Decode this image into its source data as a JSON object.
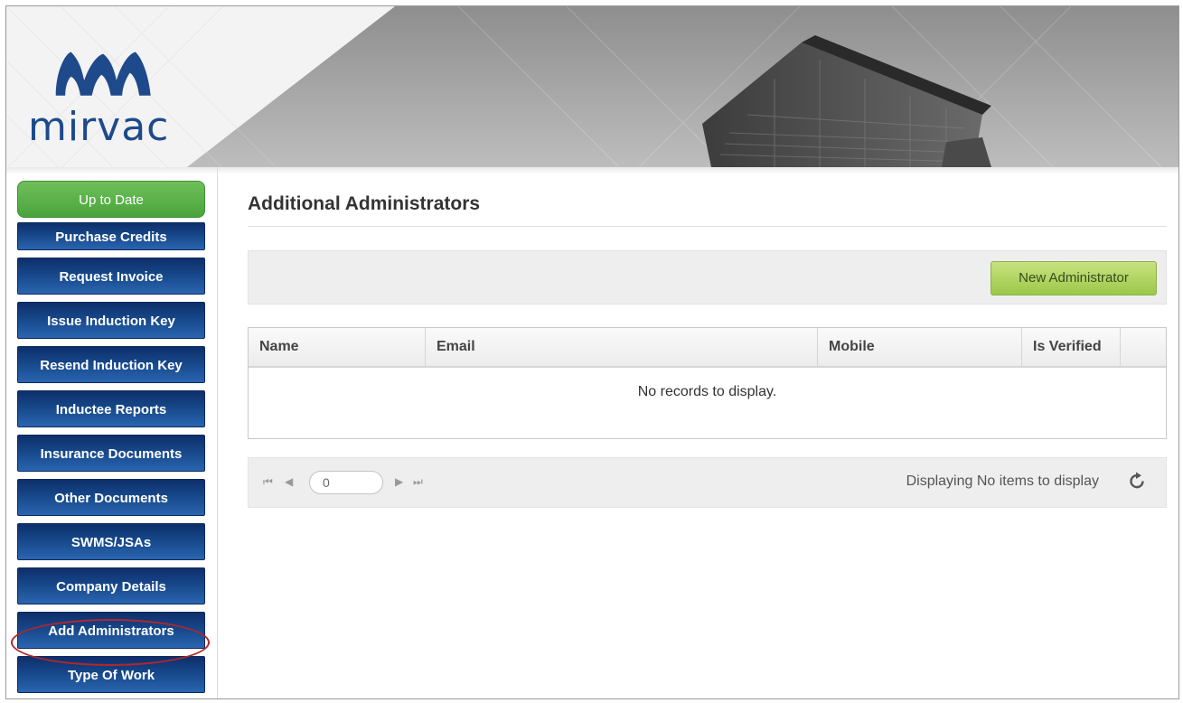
{
  "brand": {
    "logo_text": "mirvac",
    "logo_color": "#1e4a8c"
  },
  "sidebar": {
    "items": [
      {
        "label": "Up to Date",
        "style": "green"
      },
      {
        "label": "Purchase Credits"
      },
      {
        "label": "Request Invoice"
      },
      {
        "label": "Issue Induction Key"
      },
      {
        "label": "Resend Induction Key"
      },
      {
        "label": "Inductee Reports"
      },
      {
        "label": "Insurance Documents"
      },
      {
        "label": "Other Documents"
      },
      {
        "label": "SWMS/JSAs"
      },
      {
        "label": "Company Details"
      },
      {
        "label": "Add Administrators",
        "highlighted": true
      },
      {
        "label": "Type Of Work"
      }
    ]
  },
  "main": {
    "title": "Additional Administrators",
    "toolbar": {
      "new_button": "New Administrator"
    },
    "grid": {
      "columns": [
        "Name",
        "Email",
        "Mobile",
        "Is Verified"
      ],
      "empty_message": "No records to display."
    },
    "pager": {
      "page_value": "0",
      "status": "Displaying No items to display",
      "icons": [
        "first-page-icon",
        "prev-page-icon",
        "next-page-icon",
        "last-page-icon",
        "refresh-icon"
      ]
    }
  },
  "colors": {
    "nav_blue": "#164789",
    "status_green": "#5bb14a",
    "button_green": "#b2d565",
    "highlight_red": "#b3262b"
  }
}
